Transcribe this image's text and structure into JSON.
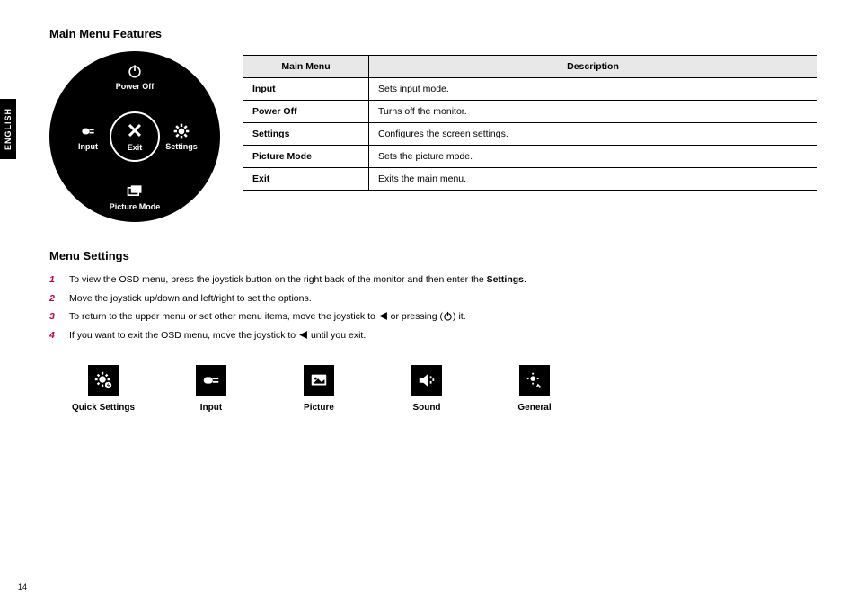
{
  "sideTab": "ENGLISH",
  "heading1": "Main Menu Features",
  "dial": {
    "top": "Power Off",
    "left": "Input",
    "right": "Settings",
    "bottom": "Picture Mode",
    "center": "Exit"
  },
  "table": {
    "h1": "Main Menu",
    "h2": "Description",
    "rows": [
      {
        "k": "Input",
        "v": "Sets input mode."
      },
      {
        "k": "Power Off",
        "v": "Turns off the monitor."
      },
      {
        "k": "Settings",
        "v": "Configures the screen settings."
      },
      {
        "k": "Picture Mode",
        "v": "Sets the picture mode."
      },
      {
        "k": "Exit",
        "v": "Exits the main menu."
      }
    ]
  },
  "heading2": "Menu Settings",
  "steps": {
    "s1a": "To view the OSD menu, press the joystick button on the right back of the monitor and then enter the ",
    "s1b": "Settings",
    "s1c": ".",
    "s2": "Move the joystick up/down and left/right to set the options.",
    "s3a": "To return to the upper menu or set other menu items, move the joystick to ",
    "s3b": " or pressing (",
    "s3c": ") it.",
    "s4a": "If you want to exit the OSD menu, move the joystick to ",
    "s4b": " until you exit."
  },
  "icons": {
    "i1": "Quick Settings",
    "i2": "Input",
    "i3": "Picture",
    "i4": "Sound",
    "i5": "General"
  },
  "pageNumber": "14"
}
